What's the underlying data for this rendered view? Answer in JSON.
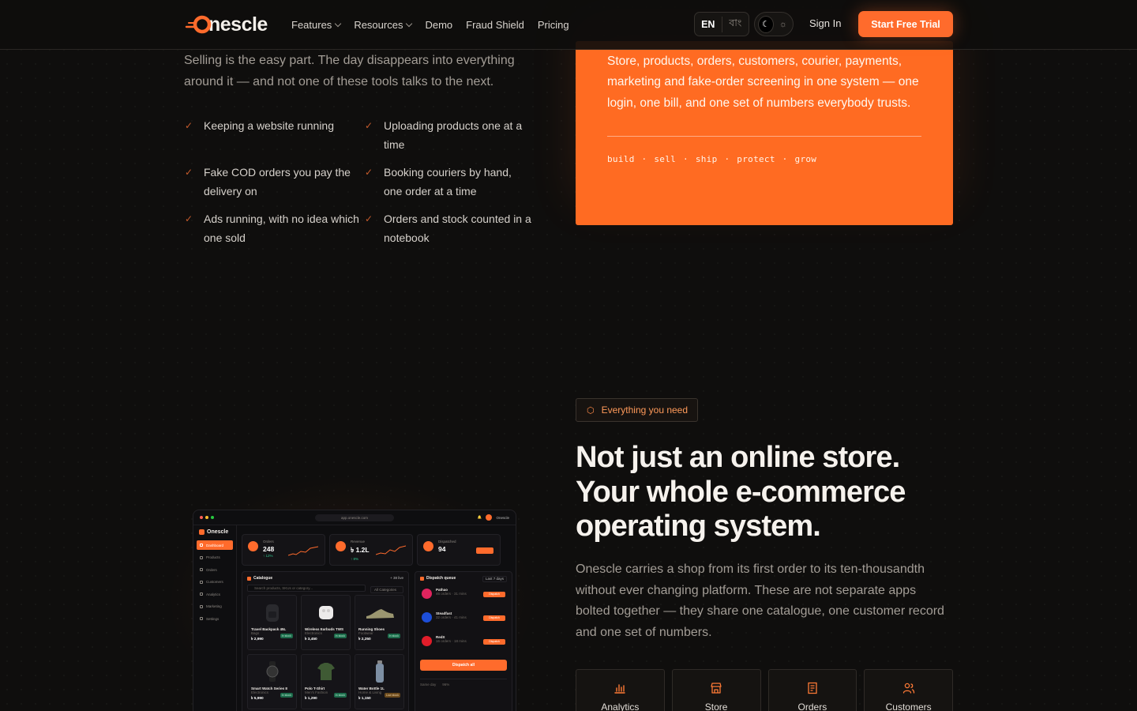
{
  "nav": {
    "brand_prefix": "O",
    "brand_suffix": "nescle",
    "links": [
      {
        "label": "Features",
        "has_dropdown": true
      },
      {
        "label": "Resources",
        "has_dropdown": true
      },
      {
        "label": "Demo",
        "has_dropdown": false
      },
      {
        "label": "Fraud Shield",
        "has_dropdown": false
      },
      {
        "label": "Pricing",
        "has_dropdown": false
      }
    ],
    "lang_active": "EN",
    "lang_alt": "বাং",
    "theme_icons": [
      "moon-icon",
      "sun-icon"
    ],
    "sign_in": "Sign In",
    "cta": "Start Free Trial"
  },
  "problem": {
    "intro": "Selling is the easy part. The day disappears into everything around it — and not one of these tools talks to the next.",
    "items": [
      "Keeping a website running",
      "Uploading products one at a time",
      "Fake COD orders you pay the delivery on",
      "Booking couriers by hand, one order at a time",
      "Ads running, with no idea which one sold",
      "Orders and stock counted in a notebook"
    ]
  },
  "card": {
    "text": "Store, products, orders, customers, courier, payments, marketing and fake-order screening in one system — one login, one bill, and one set of numbers everybody trusts.",
    "tags": "build · sell · ship · protect · grow"
  },
  "features": {
    "badge": "Everything you need",
    "headline": "Not just an online store. Your whole e-commerce operating system.",
    "lede": "Onescle carries a shop from its first order to its ten-thousandth without ever changing platform. These are not separate apps bolted together — they share one catalogue, one customer record and one set of numbers.",
    "tiles": [
      {
        "label": "Analytics",
        "icon": "bar-chart-icon"
      },
      {
        "label": "Store",
        "icon": "storefront-icon"
      },
      {
        "label": "Orders",
        "icon": "receipt-icon"
      },
      {
        "label": "Customers",
        "icon": "users-icon"
      }
    ]
  },
  "mockup": {
    "url": "app.onescle.com",
    "account": "Onescle",
    "brand": "Onescle",
    "sidebar": [
      "Dashboard",
      "Products",
      "Orders",
      "Customers",
      "Analytics",
      "Marketing",
      "Settings"
    ],
    "stats": [
      {
        "label": "Orders",
        "value": "248",
        "delta": "↑ 12%"
      },
      {
        "label": "Revenue",
        "value": "৳ 1.2L",
        "delta": "↑ 8%"
      },
      {
        "label": "Dispatched",
        "value": "94",
        "delta": ""
      }
    ],
    "catalogue": {
      "title": "Catalogue",
      "add": "+ 38 live",
      "search": "Search products, SKUs or category...",
      "filter": "All Categories",
      "products": [
        {
          "name": "Travel Backpack 45L",
          "sub": "Bags",
          "price": "৳ 2,990",
          "stock": "In stock"
        },
        {
          "name": "Wireless Earbuds TWS",
          "sub": "Electronics",
          "price": "৳ 3,450",
          "stock": "In stock"
        },
        {
          "name": "Running Shoes",
          "sub": "Footwear",
          "price": "৳ 2,250",
          "stock": "In stock"
        },
        {
          "name": "Smart Watch Series 8",
          "sub": "Electronics",
          "price": "৳ 5,990",
          "stock": "In stock"
        },
        {
          "name": "Polo T-Shirt",
          "sub": "Men's Fashion",
          "price": "৳ 1,290",
          "stock": "In stock"
        },
        {
          "name": "Water Bottle 1L",
          "sub": "Home & Living",
          "price": "৳ 1,150",
          "stock": "Low stock"
        }
      ]
    },
    "dispatch": {
      "title": "Dispatch queue",
      "range": "Last 7 days",
      "couriers": [
        {
          "name": "Pathao",
          "sub": "46 orders · 31 mins",
          "button": "Dispatch",
          "color": "#e0245e",
          "letter": "P"
        },
        {
          "name": "Steadfast",
          "sub": "32 orders · 41 mins",
          "button": "Dispatch",
          "color": "#1d4ed8",
          "letter": "S"
        },
        {
          "name": "RedX",
          "sub": "16 orders · 18 mins",
          "button": "Dispatch",
          "color": "#e11d2a",
          "letter": "X"
        }
      ],
      "cta": "Dispatch all",
      "foot_a": "Same day",
      "foot_b": "96%"
    }
  },
  "colors": {
    "accent": "#ff6b2c",
    "card": "#ff6b22",
    "background": "#0f0e0d"
  }
}
